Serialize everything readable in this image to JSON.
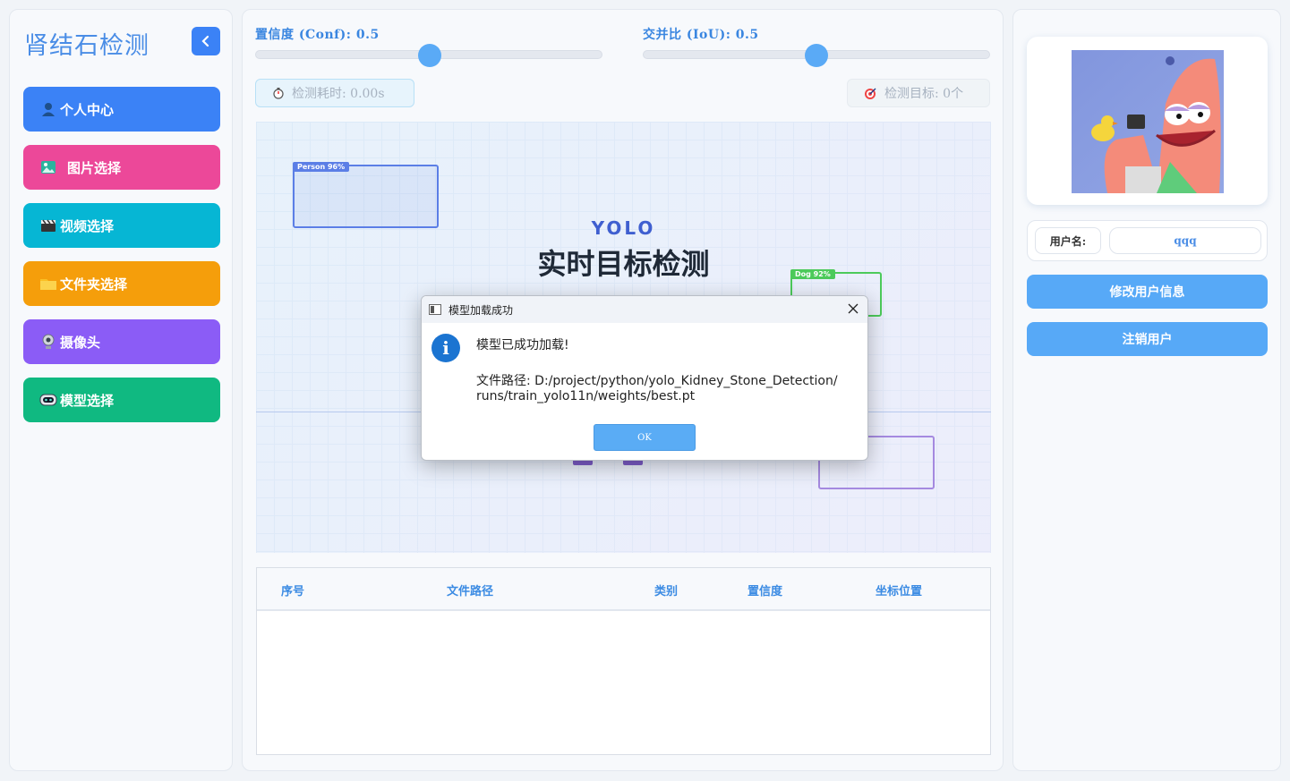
{
  "sidebar": {
    "title": "肾结石检测",
    "items": [
      {
        "label": "个人中心",
        "icon": "user-icon",
        "color": "#3b82f6"
      },
      {
        "label": "图片选择",
        "icon": "image-icon",
        "color": "#ec4899"
      },
      {
        "label": "视频选择",
        "icon": "clapperboard-icon",
        "color": "#06b6d4"
      },
      {
        "label": "文件夹选择",
        "icon": "folder-icon",
        "color": "#f59e0b"
      },
      {
        "label": "摄像头",
        "icon": "webcam-icon",
        "color": "#8b5cf6"
      },
      {
        "label": "模型选择",
        "icon": "robot-icon",
        "color": "#10b981"
      }
    ]
  },
  "controls": {
    "conf_label": "置信度 (Conf): 0.5",
    "conf_value": 0.5,
    "iou_label": "交并比 (IoU): 0.5",
    "iou_value": 0.5,
    "time_label": "检测耗时: 0.00s",
    "target_label": "检测目标: 0个"
  },
  "preview": {
    "brand": "YOLO",
    "headline": "实时目标检测",
    "boxes": [
      {
        "label": "Person 96%",
        "color": "#5b7ee6"
      },
      {
        "label": "Dog 92%",
        "color": "#4cca5a"
      },
      {
        "label": "",
        "color": "#a58ae0"
      }
    ]
  },
  "table": {
    "headers": [
      "序号",
      "文件路径",
      "类别",
      "置信度",
      "坐标位置"
    ],
    "rows": []
  },
  "user": {
    "name_label": "用户名:",
    "name_value": "qqq",
    "edit_button": "修改用户信息",
    "logout_button": "注销用户"
  },
  "dialog": {
    "title": "模型加载成功",
    "message": "模型已成功加载!",
    "path_line1": "文件路径: D:/project/python/yolo_Kidney_Stone_Detection/",
    "path_line2": "runs/train_yolo11n/weights/best.pt",
    "ok_label": "OK"
  }
}
